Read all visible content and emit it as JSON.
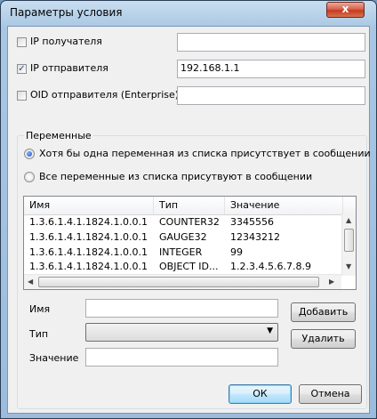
{
  "window": {
    "title": "Параметры условия",
    "close_glyph": "x"
  },
  "filters": {
    "recipient_ip": {
      "label": "IP получателя",
      "checked": false,
      "value": ""
    },
    "sender_ip": {
      "label": "IP отправителя",
      "checked": true,
      "value": "192.168.1.1"
    },
    "sender_oid": {
      "label": "OID отправителя (Enterprise)",
      "checked": false,
      "value": ""
    }
  },
  "variables": {
    "group_title": "Переменные",
    "radio_any": {
      "label": "Хотя бы одна переменная из списка присутствует в сообщении",
      "selected": true
    },
    "radio_all": {
      "label": "Все переменные из списка присутвуют в сообщении",
      "selected": false
    },
    "columns": [
      "Имя",
      "Тип",
      "Значение"
    ],
    "rows": [
      {
        "name": "1.3.6.1.4.1.1824.1.0.0.1",
        "type": "COUNTER32",
        "value": "3345556"
      },
      {
        "name": "1.3.6.1.4.1.1824.1.0.0.1",
        "type": "GAUGE32",
        "value": "12343212"
      },
      {
        "name": "1.3.6.1.4.1.1824.1.0.0.1",
        "type": "INTEGER",
        "value": "99"
      },
      {
        "name": "1.3.6.1.4.1.1824.1.0.0.1",
        "type": "OBJECT ID...",
        "value": "1.2.3.4.5.6.7.8.9"
      }
    ],
    "scroll_glyphs": {
      "up": "▲",
      "down": "▼",
      "left": "◀",
      "right": "▶"
    }
  },
  "editor": {
    "name_label": "Имя",
    "name_value": "",
    "type_label": "Тип",
    "type_value": "",
    "type_arrow": "▼",
    "value_label": "Значение",
    "value_value": "",
    "add_button": "Добавить",
    "delete_button": "Удалить"
  },
  "footer": {
    "ok_button": "ОК",
    "cancel_button": "Отмена"
  },
  "colors": {
    "accent": "#2a4a8a",
    "title_gradient_top": "#c9def0",
    "close_red": "#c43b1f"
  }
}
